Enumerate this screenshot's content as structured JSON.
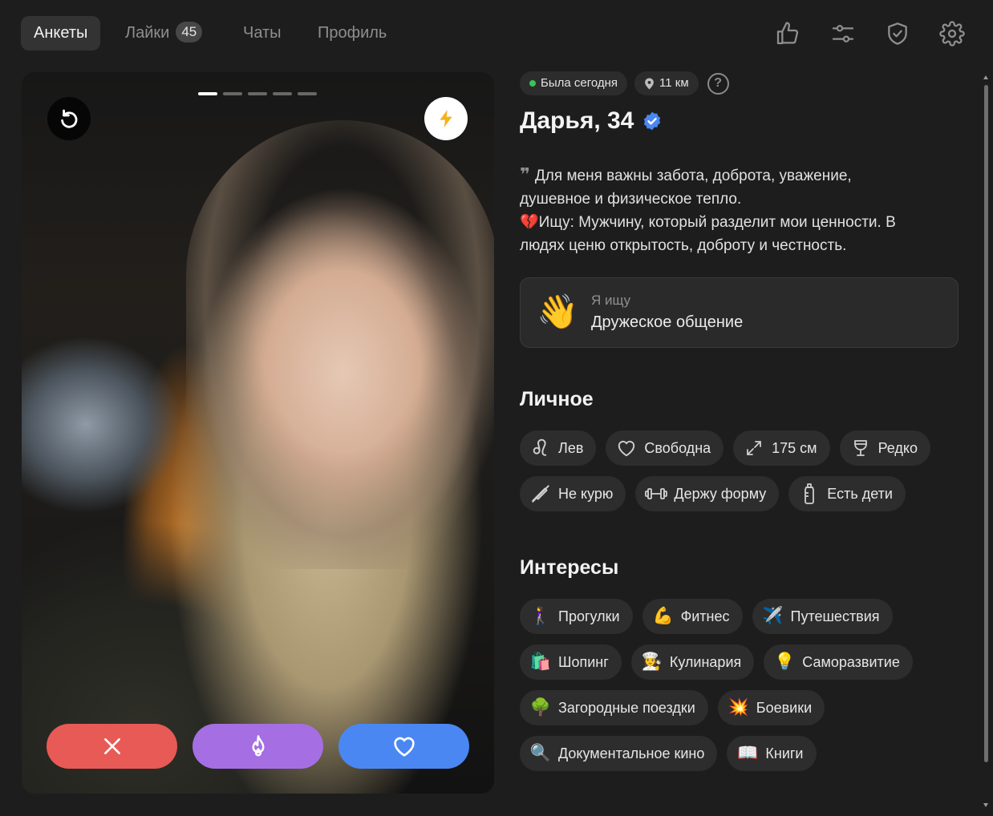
{
  "nav": {
    "tabs": [
      {
        "label": "Анкеты"
      },
      {
        "label": "Лайки",
        "badge": "45"
      },
      {
        "label": "Чаты"
      },
      {
        "label": "Профиль"
      }
    ],
    "icons": [
      "thumbs-up-icon",
      "sliders-icon",
      "shield-check-icon",
      "gear-icon"
    ]
  },
  "photo": {
    "photo_count": 5,
    "current_photo": 1,
    "colors": {
      "no": "#e85a55",
      "super": "#a56fe3",
      "like": "#4a87f2",
      "boost": "#f5b21b"
    }
  },
  "profile": {
    "status": "Была сегодня",
    "distance": "11 км",
    "help": "?",
    "name": "Дарья, 34",
    "bio_quote": "❞",
    "bio_line1": "Для меня важны забота, доброта, уважение,",
    "bio_line2": "душевное и физическое тепло.",
    "bio_line3_emoji": "💔",
    "bio_line3": "Ищу: Мужчину, который разделит мои ценности. В",
    "bio_line4": "людях ценю открытость, доброту и честность.",
    "seeking": {
      "emoji": "👋",
      "label": "Я ищу",
      "value": "Дружеское общение"
    }
  },
  "personal": {
    "title": "Личное",
    "items": [
      {
        "icon": "leo-icon",
        "label": "Лев"
      },
      {
        "icon": "heart-outline-icon",
        "label": "Свободна"
      },
      {
        "icon": "expand-arrows-icon",
        "label": "175 см"
      },
      {
        "icon": "wine-glass-icon",
        "label": "Редко"
      },
      {
        "icon": "no-smoking-icon",
        "label": "Не курю"
      },
      {
        "icon": "dumbbell-icon",
        "label": "Держу форму"
      },
      {
        "icon": "baby-bottle-icon",
        "label": "Есть дети"
      }
    ]
  },
  "interests": {
    "title": "Интересы",
    "items": [
      {
        "emoji": "🚶‍♀️",
        "label": "Прогулки"
      },
      {
        "emoji": "💪",
        "label": "Фитнес"
      },
      {
        "emoji": "✈️",
        "label": "Путешествия"
      },
      {
        "emoji": "🛍️",
        "label": "Шопинг"
      },
      {
        "emoji": "👩‍🍳",
        "label": "Кулинария"
      },
      {
        "emoji": "💡",
        "label": "Саморазвитие"
      },
      {
        "emoji": "🌳",
        "label": "Загородные поездки"
      },
      {
        "emoji": "💥",
        "label": "Боевики"
      },
      {
        "emoji": "🔍",
        "label": "Документальное кино"
      },
      {
        "emoji": "📖",
        "label": "Книги"
      }
    ]
  }
}
